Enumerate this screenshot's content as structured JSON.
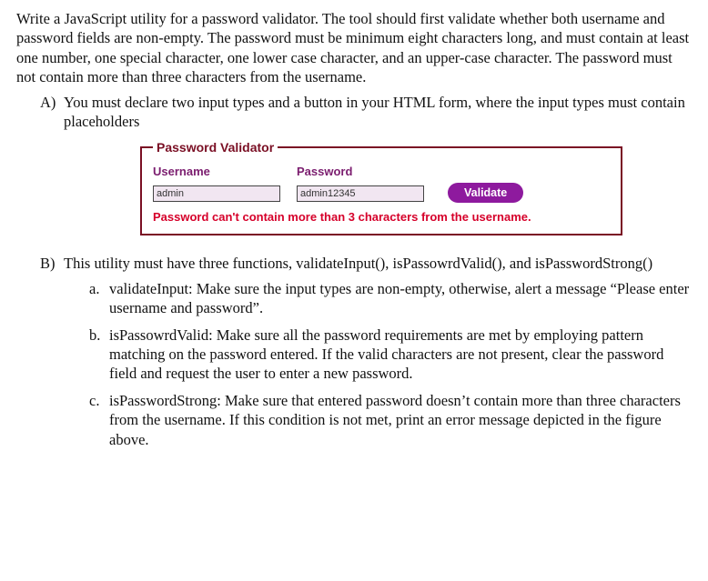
{
  "intro": "Write a JavaScript utility for a password validator. The tool should first validate whether both username and password fields are non-empty. The password must be minimum eight characters long, and must contain at least one number, one special character, one lower case character, and an upper-case character. The password must not contain more than three characters from the username.",
  "A": {
    "label": "A)",
    "text": "You must declare two input types and a button in your HTML form, where the input types must contain placeholders"
  },
  "form": {
    "legend": "Password Validator",
    "username_label": "Username",
    "password_label": "Password",
    "username_value": "admin",
    "password_value": "admin12345",
    "button_label": "Validate",
    "error_message": "Password can't contain more than 3 characters from the username."
  },
  "B": {
    "label": "B)",
    "text": "This utility must have three functions, validateInput(), isPassowrdValid(), and isPasswordStrong()",
    "a": {
      "label": "a.",
      "text": "validateInput: Make sure the input types are non-empty, otherwise, alert a message “Please enter username and password”."
    },
    "b": {
      "label": "b.",
      "text": "isPassowrdValid: Make sure all the password requirements are met by employing pattern matching on the password entered. If the valid characters are not present, clear the password field and request the user to enter a new password."
    },
    "c": {
      "label": "c.",
      "text": "isPasswordStrong: Make sure that entered password doesn’t contain more than three characters from the username. If this condition is not met, print an error message depicted in the figure above."
    }
  }
}
